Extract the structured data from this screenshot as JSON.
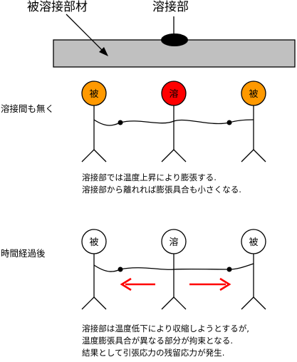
{
  "labels": {
    "base_metal": "被溶接部材",
    "weld": "溶接部"
  },
  "stages": [
    {
      "side_label": "溶接間も無く",
      "heads": [
        "被",
        "溶",
        "被"
      ],
      "head_colors": [
        "#ff9900",
        "#ff0000",
        "#ff9900"
      ],
      "description": [
        "溶接部では温度上昇により膨張する.",
        "溶接部から離れれば膨張具合も小さくなる."
      ]
    },
    {
      "side_label": "時間経過後",
      "heads": [
        "被",
        "溶",
        "被"
      ],
      "head_colors": [
        "#ffffff",
        "#ffffff",
        "#ffffff"
      ],
      "description": [
        "溶接部は温度低下により収縮しようとするが,",
        "温度膨張具合が異なる部分が拘束となる.",
        "結果として引張応力の残留応力が発生."
      ]
    }
  ],
  "colors": {
    "plate_fill": "#c0c0c0",
    "weld_bead": "#000000",
    "arrow": "#ff0000"
  }
}
